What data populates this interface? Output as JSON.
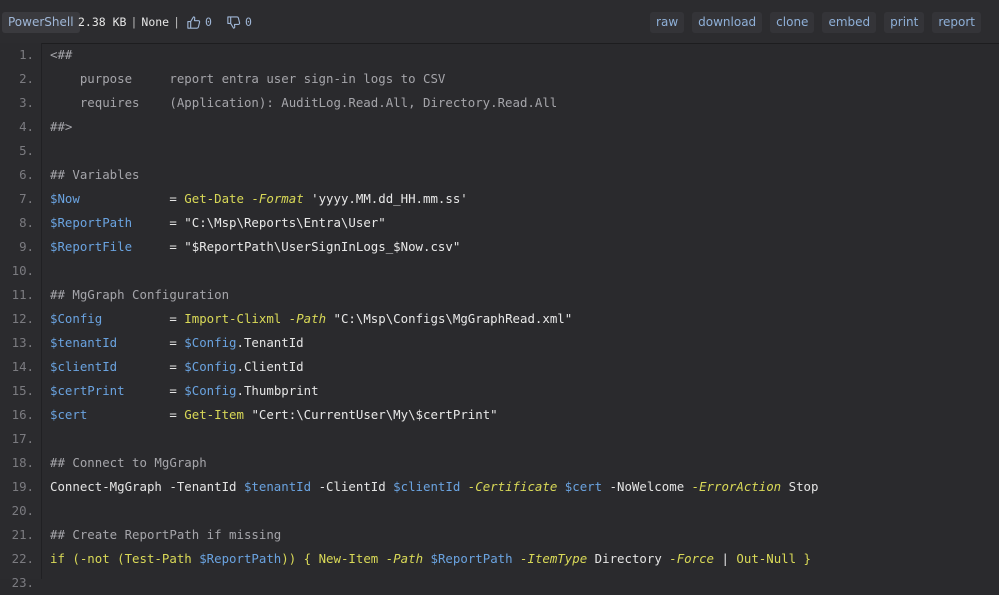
{
  "header": {
    "language": "PowerShell",
    "size": "2.38 KB",
    "separator": "|",
    "license": "None",
    "upvotes": "0",
    "downvotes": "0",
    "actions": [
      "raw",
      "download",
      "clone",
      "embed",
      "print",
      "report"
    ]
  },
  "code": {
    "lines": [
      {
        "n": "1.",
        "tokens": [
          {
            "t": "<##",
            "c": "comment"
          }
        ]
      },
      {
        "n": "2.",
        "tokens": [
          {
            "t": "    purpose     report entra user sign-in logs to CSV",
            "c": "comment"
          }
        ]
      },
      {
        "n": "3.",
        "tokens": [
          {
            "t": "    requires    (Application): AuditLog.Read.All, Directory.Read.All",
            "c": "comment"
          }
        ]
      },
      {
        "n": "4.",
        "tokens": [
          {
            "t": "##>",
            "c": "comment"
          }
        ]
      },
      {
        "n": "5.",
        "tokens": []
      },
      {
        "n": "6.",
        "tokens": [
          {
            "t": "## Variables",
            "c": "comment"
          }
        ]
      },
      {
        "n": "7.",
        "tokens": [
          {
            "t": "$Now",
            "c": "var"
          },
          {
            "t": "            = ",
            "c": "plain"
          },
          {
            "t": "Get-Date",
            "c": "cmd"
          },
          {
            "t": " ",
            "c": "plain"
          },
          {
            "t": "-Format",
            "c": "param"
          },
          {
            "t": " 'yyyy.MM.dd_HH.mm.ss'",
            "c": "str"
          }
        ]
      },
      {
        "n": "8.",
        "tokens": [
          {
            "t": "$ReportPath",
            "c": "var"
          },
          {
            "t": "     = ",
            "c": "plain"
          },
          {
            "t": "\"C:\\Msp\\Reports\\Entra\\User\"",
            "c": "str"
          }
        ]
      },
      {
        "n": "9.",
        "tokens": [
          {
            "t": "$ReportFile",
            "c": "var"
          },
          {
            "t": "     = ",
            "c": "plain"
          },
          {
            "t": "\"$ReportPath\\UserSignInLogs_$Now.csv\"",
            "c": "str"
          }
        ]
      },
      {
        "n": "10.",
        "tokens": []
      },
      {
        "n": "11.",
        "tokens": [
          {
            "t": "## MgGraph Configuration",
            "c": "comment"
          }
        ]
      },
      {
        "n": "12.",
        "tokens": [
          {
            "t": "$Config",
            "c": "var"
          },
          {
            "t": "         = ",
            "c": "plain"
          },
          {
            "t": "Import-Clixml",
            "c": "cmd"
          },
          {
            "t": " ",
            "c": "plain"
          },
          {
            "t": "-Path",
            "c": "param"
          },
          {
            "t": " \"C:\\Msp\\Configs\\MgGraphRead.xml\"",
            "c": "str"
          }
        ]
      },
      {
        "n": "13.",
        "tokens": [
          {
            "t": "$tenantId",
            "c": "var"
          },
          {
            "t": "       = ",
            "c": "plain"
          },
          {
            "t": "$Config",
            "c": "var"
          },
          {
            "t": ".TenantId",
            "c": "plain"
          }
        ]
      },
      {
        "n": "14.",
        "tokens": [
          {
            "t": "$clientId",
            "c": "var"
          },
          {
            "t": "       = ",
            "c": "plain"
          },
          {
            "t": "$Config",
            "c": "var"
          },
          {
            "t": ".ClientId",
            "c": "plain"
          }
        ]
      },
      {
        "n": "15.",
        "tokens": [
          {
            "t": "$certPrint",
            "c": "var"
          },
          {
            "t": "      = ",
            "c": "plain"
          },
          {
            "t": "$Config",
            "c": "var"
          },
          {
            "t": ".Thumbprint",
            "c": "plain"
          }
        ]
      },
      {
        "n": "16.",
        "tokens": [
          {
            "t": "$cert",
            "c": "var"
          },
          {
            "t": "           = ",
            "c": "plain"
          },
          {
            "t": "Get-Item",
            "c": "cmd"
          },
          {
            "t": " \"Cert:\\CurrentUser\\My\\$certPrint\"",
            "c": "str"
          }
        ]
      },
      {
        "n": "17.",
        "tokens": []
      },
      {
        "n": "18.",
        "tokens": [
          {
            "t": "## Connect to MgGraph",
            "c": "comment"
          }
        ]
      },
      {
        "n": "19.",
        "tokens": [
          {
            "t": "Connect-MgGraph -TenantId ",
            "c": "plain"
          },
          {
            "t": "$tenantId",
            "c": "var"
          },
          {
            "t": " -ClientId ",
            "c": "plain"
          },
          {
            "t": "$clientId",
            "c": "var"
          },
          {
            "t": " ",
            "c": "plain"
          },
          {
            "t": "-Certificate",
            "c": "param"
          },
          {
            "t": " ",
            "c": "plain"
          },
          {
            "t": "$cert",
            "c": "var"
          },
          {
            "t": " -NoWelcome ",
            "c": "plain"
          },
          {
            "t": "-ErrorAction",
            "c": "param"
          },
          {
            "t": " Stop",
            "c": "plain"
          }
        ]
      },
      {
        "n": "20.",
        "tokens": []
      },
      {
        "n": "21.",
        "tokens": [
          {
            "t": "## Create ReportPath if missing",
            "c": "comment"
          }
        ]
      },
      {
        "n": "22.",
        "tokens": [
          {
            "t": "if (-not (Test-Path ",
            "c": "cmd"
          },
          {
            "t": "$ReportPath",
            "c": "var"
          },
          {
            "t": ")) { ",
            "c": "cmd"
          },
          {
            "t": "New-Item",
            "c": "cmd"
          },
          {
            "t": " ",
            "c": "plain"
          },
          {
            "t": "-Path",
            "c": "param"
          },
          {
            "t": " ",
            "c": "plain"
          },
          {
            "t": "$ReportPath",
            "c": "var"
          },
          {
            "t": " ",
            "c": "plain"
          },
          {
            "t": "-ItemType",
            "c": "param"
          },
          {
            "t": " Directory ",
            "c": "plain"
          },
          {
            "t": "-Force",
            "c": "param"
          },
          {
            "t": " | ",
            "c": "plain"
          },
          {
            "t": "Out-Null",
            "c": "cmd"
          },
          {
            "t": " }",
            "c": "cmd"
          }
        ]
      },
      {
        "n": "23.",
        "tokens": []
      }
    ]
  }
}
